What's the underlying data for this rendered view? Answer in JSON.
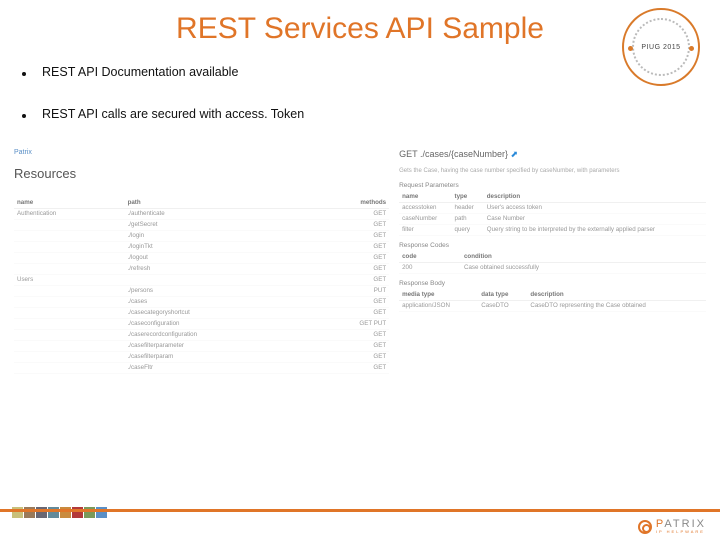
{
  "title": "REST Services API Sample",
  "bullets": [
    "REST API Documentation available",
    "REST API calls are secured with access. Token"
  ],
  "badge": {
    "center": "PIUG 2015"
  },
  "doc_left": {
    "crumb": "Patrix",
    "heading": "Resources",
    "cols": [
      "name",
      "path",
      "methods"
    ],
    "rows": [
      [
        "Authentication",
        "./authenticate",
        "GET"
      ],
      [
        "",
        "./getSecret",
        "GET"
      ],
      [
        "",
        "./login",
        "GET"
      ],
      [
        "",
        "./loginTkt",
        "GET"
      ],
      [
        "",
        "./logout",
        "GET"
      ],
      [
        "",
        "./refresh",
        "GET"
      ],
      [
        "Users",
        "",
        "GET"
      ],
      [
        "",
        "./persons",
        "PUT"
      ],
      [
        "",
        "./cases",
        "GET"
      ],
      [
        "",
        "./casecategoryshortcut",
        "GET"
      ],
      [
        "",
        "./caseconfiguration",
        "GET PUT"
      ],
      [
        "",
        "./caserecordconfiguration",
        "GET"
      ],
      [
        "",
        "./casefilterparameter",
        "GET"
      ],
      [
        "",
        "./casefilterparam",
        "GET"
      ],
      [
        "",
        "./caseFltr",
        "GET"
      ]
    ]
  },
  "doc_right": {
    "get_line": "GET ./cases/{caseNumber}",
    "get_desc": "Gets the Case, having the case number specified by caseNumber, with parameters",
    "req_head": "Request Parameters",
    "req_cols": [
      "name",
      "type",
      "description"
    ],
    "req_rows": [
      [
        "accesstoken",
        "header",
        "User's access token"
      ],
      [
        "caseNumber",
        "path",
        "Case Number"
      ],
      [
        "filter",
        "query",
        "Query string to be interpreted by the externally applied parser"
      ]
    ],
    "resp_head": "Response Codes",
    "resp_cols": [
      "code",
      "condition"
    ],
    "resp_rows": [
      [
        "200",
        "Case obtained successfully"
      ]
    ],
    "body_head": "Response Body",
    "body_cols": [
      "media type",
      "data type",
      "description"
    ],
    "body_rows": [
      [
        "application/JSON",
        "CaseDTO",
        "CaseDTO representing the Case obtained"
      ]
    ]
  },
  "chips": [
    "#c9c07a",
    "#9a7a5a",
    "#696773",
    "#638a9a",
    "#c98b3e",
    "#b33939",
    "#7a9a5a",
    "#5a8fc6"
  ],
  "logo": {
    "name": "PATRIX",
    "sub": "IP HELPWARE"
  }
}
